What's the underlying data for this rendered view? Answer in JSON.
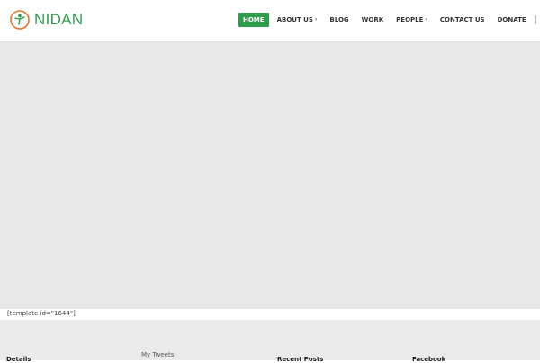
{
  "brand": {
    "name": "NIDAN",
    "logo_icon": "person-logo-icon",
    "colors": {
      "accent": "#2e9e4c",
      "logo_ring": "#e8732a"
    }
  },
  "nav": {
    "items": [
      {
        "label": "HOME",
        "active": true,
        "has_dropdown": false
      },
      {
        "label": "ABOUT US",
        "active": false,
        "has_dropdown": true
      },
      {
        "label": "BLOG",
        "active": false,
        "has_dropdown": false
      },
      {
        "label": "WORK",
        "active": false,
        "has_dropdown": false
      },
      {
        "label": "PEOPLE",
        "active": false,
        "has_dropdown": true
      },
      {
        "label": "CONTACT US",
        "active": false,
        "has_dropdown": false
      },
      {
        "label": "DONATE",
        "active": false,
        "has_dropdown": false
      }
    ],
    "dropdown_glyph": "▾",
    "search_icon": "search-icon"
  },
  "content": {
    "template_shortcode": "[template id=\"1644\"]"
  },
  "footer": {
    "columns": {
      "details": "Details",
      "tweets": "My Tweets",
      "recent_posts": "Recent Posts",
      "facebook": "Facebook"
    }
  }
}
